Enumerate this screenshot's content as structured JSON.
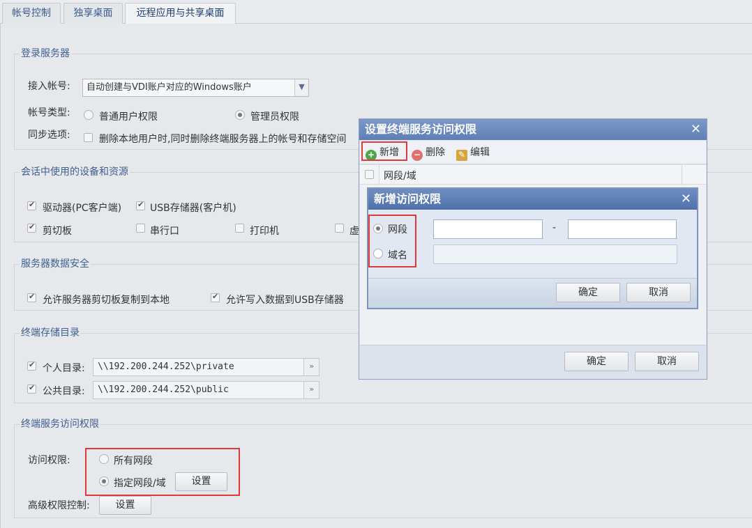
{
  "tabs": [
    "帐号控制",
    "独享桌面",
    "远程应用与共享桌面"
  ],
  "login_server": {
    "legend": "登录服务器",
    "access_account_label": "接入帐号:",
    "access_account_value": "自动创建与VDI账户对应的Windows账户",
    "account_type_label": "帐号类型:",
    "account_type_options": [
      "普通用户权限",
      "管理员权限"
    ],
    "account_type_selected": "管理员权限",
    "sync_label": "同步选项:",
    "sync_text": "删除本地用户时,同时删除终端服务器上的帐号和存储空间"
  },
  "devices": {
    "legend": "会话中使用的设备和资源",
    "items": [
      {
        "label": "驱动器(PC客户端)",
        "checked": true
      },
      {
        "label": "USB存储器(客户机)",
        "checked": true
      },
      {
        "label": "剪切板",
        "checked": true
      },
      {
        "label": "串行口",
        "checked": false
      },
      {
        "label": "打印机",
        "checked": false
      },
      {
        "label": "虚",
        "checked": false
      }
    ]
  },
  "data_security": {
    "legend": "服务器数据安全",
    "items": [
      {
        "label": "允许服务器剪切板复制到本地",
        "checked": true
      },
      {
        "label": "允许写入数据到USB存储器",
        "checked": true
      }
    ]
  },
  "storage": {
    "legend": "终端存储目录",
    "personal_label": "个人目录:",
    "personal_path": "\\\\192.200.244.252\\private",
    "public_label": "公共目录:",
    "public_path": "\\\\192.200.244.252\\public"
  },
  "access": {
    "legend": "终端服务访问权限",
    "access_label": "访问权限:",
    "options": [
      "所有网段",
      "指定网段/域"
    ],
    "selected": "指定网段/域",
    "set_button": "设置",
    "advanced_label": "高级权限控制:",
    "advanced_button": "设置"
  },
  "dialog_outer": {
    "title": "设置终端服务访问权限",
    "close": "✕",
    "toolbar": {
      "add": "新增",
      "delete": "删除",
      "edit": "编辑"
    },
    "column": "网段/域",
    "ok": "确定",
    "cancel": "取消"
  },
  "dialog_inner": {
    "title": "新增访问权限",
    "close": "✕",
    "options": [
      "网段",
      "域名"
    ],
    "selected": "网段",
    "range_sep": "-",
    "ok": "确定",
    "cancel": "取消"
  },
  "colors": {
    "highlight": "#e0393a",
    "title_bar": "#6a88bc",
    "legend": "#3e5f92"
  }
}
